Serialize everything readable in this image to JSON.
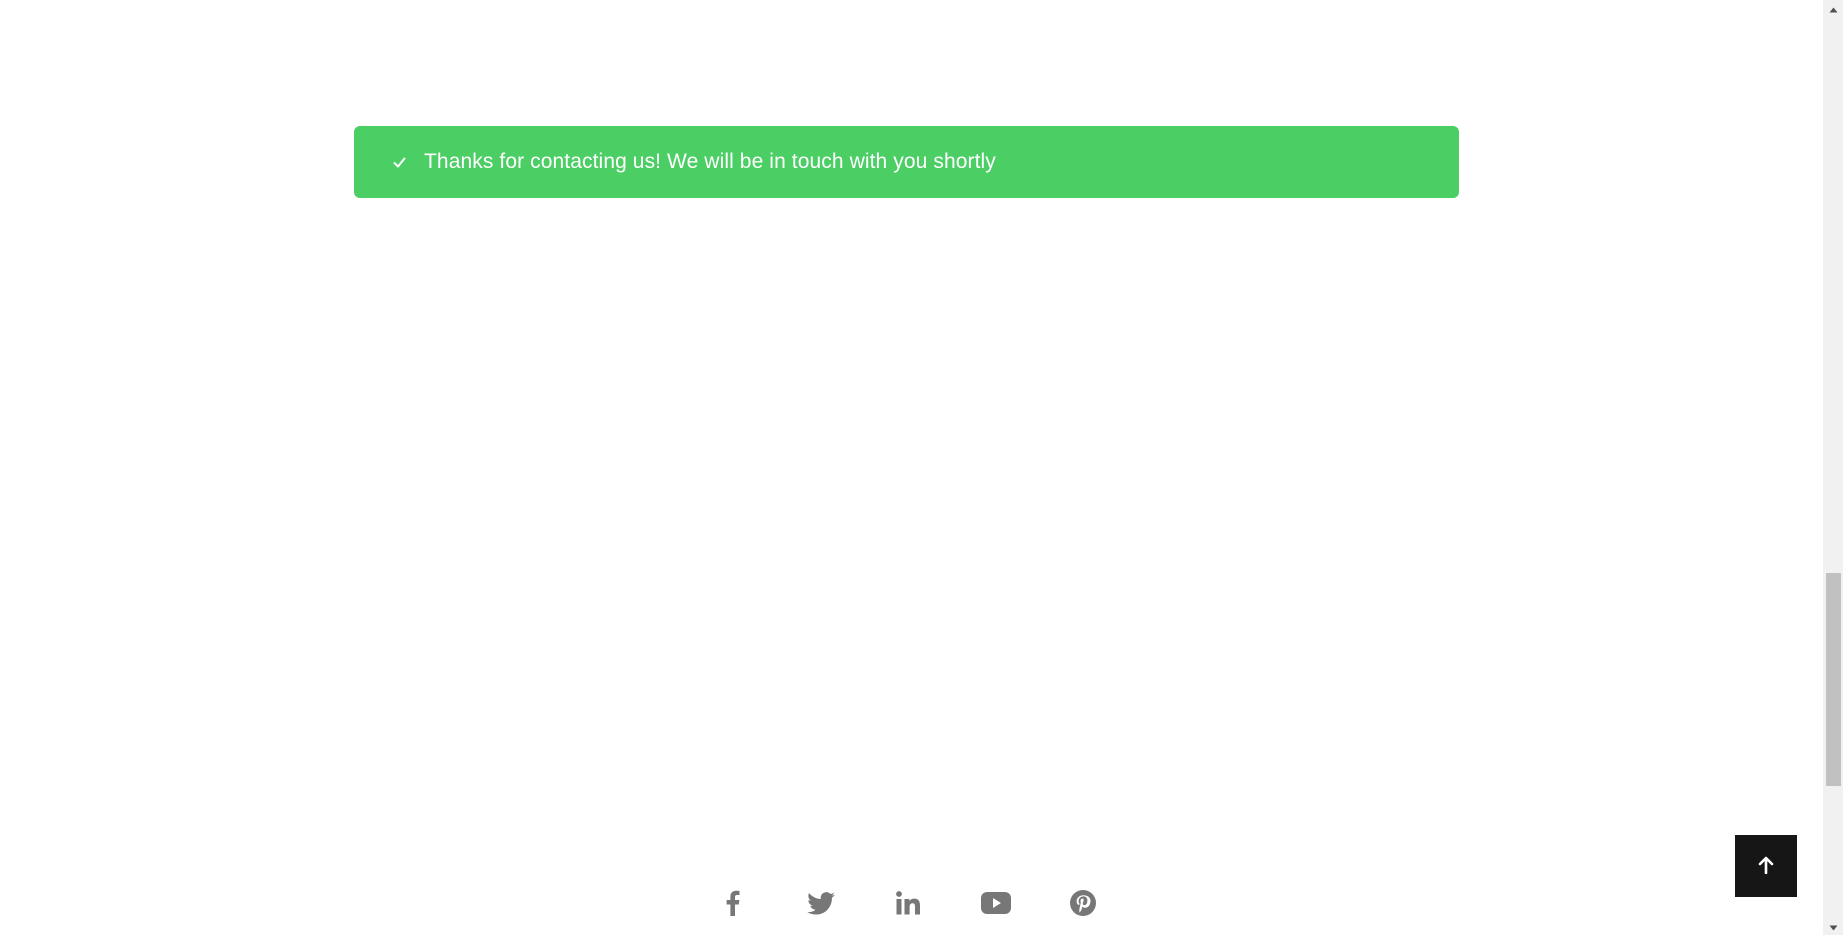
{
  "alert": {
    "message": "Thanks for contacting us! We will be in touch with you shortly",
    "icon": "check-icon",
    "background_color": "#4bce64",
    "text_color": "#ffffff"
  },
  "social": {
    "icon_color": "#777777",
    "links": [
      {
        "name": "facebook",
        "icon": "facebook-icon"
      },
      {
        "name": "twitter",
        "icon": "twitter-icon"
      },
      {
        "name": "linkedin",
        "icon": "linkedin-icon"
      },
      {
        "name": "youtube",
        "icon": "youtube-icon"
      },
      {
        "name": "pinterest",
        "icon": "pinterest-icon"
      }
    ]
  },
  "back_to_top": {
    "icon": "arrow-up-icon",
    "background_color": "#161616"
  },
  "scrollbar": {
    "icon_up": "scroll-up-arrow-icon",
    "icon_down": "scroll-down-arrow-icon"
  }
}
